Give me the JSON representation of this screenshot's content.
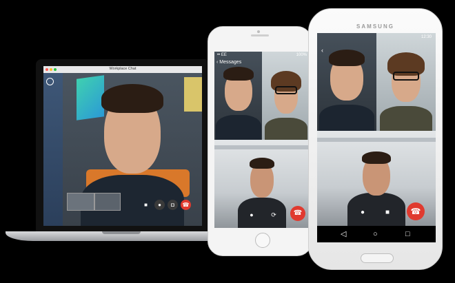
{
  "laptop": {
    "window_title": "Workplace Chat",
    "controls": [
      "video-icon",
      "mic-icon",
      "camera-icon",
      "end-call-icon"
    ]
  },
  "iphone": {
    "status_carrier": "•• EE",
    "status_battery": "100%",
    "back_label": "Messages",
    "controls": [
      "mic-icon",
      "switch-camera-icon",
      "end-call-icon"
    ]
  },
  "samsung": {
    "brand": "SAMSUNG",
    "status_time": "12:30",
    "controls": [
      "mic-icon",
      "video-off-icon",
      "end-call-icon"
    ],
    "nav": [
      "back-icon",
      "home-icon",
      "recents-icon"
    ]
  },
  "colors": {
    "end_call": "#e03a2f",
    "background": "#000000"
  }
}
